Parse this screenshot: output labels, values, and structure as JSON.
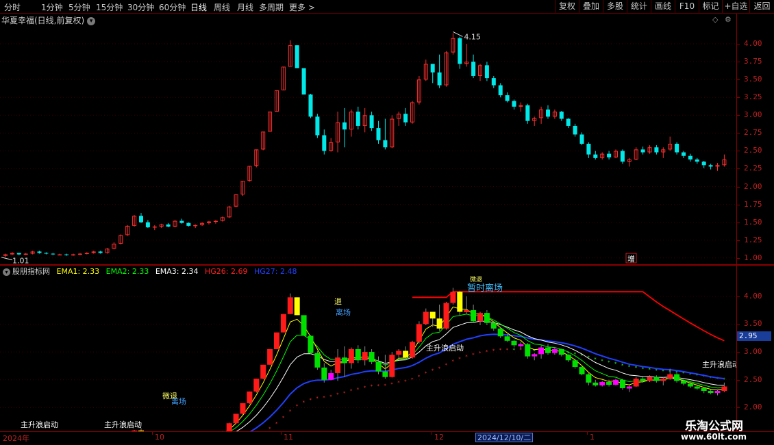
{
  "toolbar": {
    "timeframes": [
      "分时",
      "1分钟",
      "5分钟",
      "15分钟",
      "30分钟",
      "60分钟",
      "日线",
      "周线",
      "月线",
      "多周期",
      "更多"
    ],
    "active_timeframe": "日线",
    "more_arrow": ">",
    "right_buttons": [
      "复权",
      "叠加",
      "多股",
      "统计",
      "画线",
      "F10",
      "标记",
      "+自选",
      "返回"
    ]
  },
  "upper": {
    "title": "华夏幸福(日线,前复权)",
    "price_labels": [
      "4.00",
      "3.75",
      "3.50",
      "3.25",
      "3.00",
      "2.75",
      "2.50",
      "2.25",
      "2.00",
      "1.75",
      "1.50",
      "1.25",
      "1.00"
    ],
    "high_marker": "4.15",
    "low_marker": "1.01",
    "zeng_label": "增"
  },
  "lower": {
    "indicator_name": "股朋指标网",
    "legend": {
      "ema1": "EMA1: 2.33",
      "ema2": "EMA2: 2.33",
      "ema3": "EMA3: 2.34",
      "hg26": "HG26: 2.69",
      "hg27": "HG27: 2.48"
    },
    "price_labels": [
      "4.00",
      "3.50",
      "3.00",
      "2.50",
      "2.00"
    ],
    "last_price": "2.95",
    "annotations": {
      "zhushengqidong": "主升浪启动",
      "zanshilichang": "暂时离场",
      "lichang": "离场",
      "tui": "退",
      "weitui": "微退"
    }
  },
  "date_axis": {
    "labels": [
      "2024年",
      "10",
      "11",
      "12",
      "1"
    ],
    "cursor_date": "2024/12/10/二"
  },
  "watermark": {
    "main": "乐淘公式网",
    "sub": "www.60lt.com"
  },
  "colors": {
    "up": "#ff3030",
    "down": "#00e8e8",
    "background": "#000000",
    "axis": "#c02020",
    "ema1": "#ffff00",
    "ema2": "#00ff00",
    "ema3": "#ffffff",
    "hg26": "#ff0000",
    "hg27": "#2040ff"
  },
  "chart_data": {
    "type": "candlestick",
    "ylim_upper": [
      0.95,
      4.25
    ],
    "ylim_lower": [
      1.6,
      4.5
    ],
    "candles": [
      [
        1.03,
        1.06,
        1.01,
        1.05
      ],
      [
        1.05,
        1.08,
        1.04,
        1.07
      ],
      [
        1.07,
        1.07,
        1.04,
        1.05
      ],
      [
        1.05,
        1.07,
        1.04,
        1.06
      ],
      [
        1.06,
        1.1,
        1.05,
        1.09
      ],
      [
        1.09,
        1.1,
        1.06,
        1.07
      ],
      [
        1.07,
        1.08,
        1.05,
        1.06
      ],
      [
        1.06,
        1.07,
        1.04,
        1.05
      ],
      [
        1.05,
        1.06,
        1.04,
        1.05
      ],
      [
        1.05,
        1.06,
        1.03,
        1.04
      ],
      [
        1.04,
        1.06,
        1.03,
        1.05
      ],
      [
        1.05,
        1.07,
        1.04,
        1.06
      ],
      [
        1.06,
        1.08,
        1.05,
        1.07
      ],
      [
        1.07,
        1.1,
        1.06,
        1.09
      ],
      [
        1.09,
        1.1,
        1.06,
        1.07
      ],
      [
        1.07,
        1.14,
        1.06,
        1.13
      ],
      [
        1.13,
        1.22,
        1.12,
        1.2
      ],
      [
        1.2,
        1.33,
        1.19,
        1.32
      ],
      [
        1.32,
        1.46,
        1.31,
        1.45
      ],
      [
        1.45,
        1.6,
        1.44,
        1.59
      ],
      [
        1.59,
        1.63,
        1.49,
        1.5
      ],
      [
        1.5,
        1.53,
        1.42,
        1.43
      ],
      [
        1.43,
        1.46,
        1.39,
        1.44
      ],
      [
        1.44,
        1.48,
        1.42,
        1.47
      ],
      [
        1.47,
        1.49,
        1.43,
        1.44
      ],
      [
        1.44,
        1.53,
        1.43,
        1.52
      ],
      [
        1.52,
        1.55,
        1.48,
        1.49
      ],
      [
        1.49,
        1.5,
        1.44,
        1.45
      ],
      [
        1.45,
        1.47,
        1.42,
        1.46
      ],
      [
        1.46,
        1.5,
        1.45,
        1.49
      ],
      [
        1.49,
        1.52,
        1.47,
        1.51
      ],
      [
        1.51,
        1.53,
        1.48,
        1.52
      ],
      [
        1.52,
        1.58,
        1.51,
        1.57
      ],
      [
        1.57,
        1.73,
        1.56,
        1.72
      ],
      [
        1.72,
        1.89,
        1.71,
        1.89
      ],
      [
        1.89,
        2.08,
        1.87,
        2.08
      ],
      [
        2.08,
        2.29,
        2.07,
        2.29
      ],
      [
        2.29,
        2.52,
        2.27,
        2.52
      ],
      [
        2.52,
        2.77,
        2.51,
        2.77
      ],
      [
        2.77,
        3.05,
        2.77,
        3.05
      ],
      [
        3.05,
        3.35,
        3.05,
        3.35
      ],
      [
        3.35,
        3.68,
        3.35,
        3.68
      ],
      [
        3.68,
        4.05,
        3.68,
        3.98
      ],
      [
        3.98,
        3.98,
        3.66,
        3.66
      ],
      [
        3.66,
        3.32,
        3.29,
        3.29
      ],
      [
        3.29,
        3.3,
        2.96,
        2.98
      ],
      [
        2.98,
        3.02,
        2.68,
        2.72
      ],
      [
        2.72,
        2.8,
        2.45,
        2.5
      ],
      [
        2.5,
        2.68,
        2.49,
        2.62
      ],
      [
        2.62,
        3.05,
        2.48,
        2.9
      ],
      [
        2.9,
        3.1,
        2.55,
        2.8
      ],
      [
        2.8,
        3.08,
        2.7,
        3.05
      ],
      [
        3.05,
        3.12,
        2.8,
        2.85
      ],
      [
        2.85,
        3.1,
        2.76,
        3.0
      ],
      [
        3.0,
        3.05,
        2.78,
        2.82
      ],
      [
        2.82,
        2.92,
        2.6,
        2.65
      ],
      [
        2.65,
        2.95,
        2.52,
        2.55
      ],
      [
        2.55,
        3.0,
        2.54,
        2.95
      ],
      [
        2.95,
        3.05,
        2.85,
        3.02
      ],
      [
        3.02,
        3.1,
        2.85,
        2.9
      ],
      [
        2.9,
        3.2,
        2.88,
        3.18
      ],
      [
        3.18,
        3.55,
        3.15,
        3.5
      ],
      [
        3.5,
        3.78,
        3.48,
        3.72
      ],
      [
        3.72,
        3.65,
        3.45,
        3.6
      ],
      [
        3.6,
        3.85,
        3.38,
        3.42
      ],
      [
        3.42,
        3.9,
        3.4,
        3.88
      ],
      [
        3.88,
        4.15,
        3.85,
        4.08
      ],
      [
        4.08,
        4.1,
        3.65,
        3.72
      ],
      [
        3.72,
        4.0,
        3.68,
        3.75
      ],
      [
        3.75,
        3.85,
        3.52,
        3.55
      ],
      [
        3.55,
        3.72,
        3.48,
        3.7
      ],
      [
        3.7,
        3.75,
        3.48,
        3.52
      ],
      [
        3.52,
        3.55,
        3.38,
        3.42
      ],
      [
        3.42,
        3.45,
        3.25,
        3.28
      ],
      [
        3.28,
        3.32,
        3.18,
        3.2
      ],
      [
        3.2,
        3.22,
        3.08,
        3.12
      ],
      [
        3.12,
        3.18,
        3.05,
        3.14
      ],
      [
        3.14,
        3.16,
        2.88,
        2.92
      ],
      [
        2.92,
        2.98,
        2.85,
        2.96
      ],
      [
        2.96,
        3.12,
        2.88,
        3.08
      ],
      [
        3.08,
        3.14,
        2.95,
        2.98
      ],
      [
        2.98,
        3.08,
        2.95,
        3.05
      ],
      [
        3.05,
        3.06,
        2.92,
        2.95
      ],
      [
        2.95,
        2.96,
        2.82,
        2.85
      ],
      [
        2.85,
        2.88,
        2.7,
        2.73
      ],
      [
        2.73,
        2.76,
        2.58,
        2.6
      ],
      [
        2.6,
        2.62,
        2.4,
        2.45
      ],
      [
        2.45,
        2.5,
        2.38,
        2.4
      ],
      [
        2.4,
        2.48,
        2.38,
        2.46
      ],
      [
        2.46,
        2.5,
        2.38,
        2.41
      ],
      [
        2.41,
        2.52,
        2.4,
        2.5
      ],
      [
        2.5,
        2.52,
        2.32,
        2.35
      ],
      [
        2.35,
        2.4,
        2.28,
        2.38
      ],
      [
        2.38,
        2.55,
        2.37,
        2.52
      ],
      [
        2.52,
        2.56,
        2.45,
        2.48
      ],
      [
        2.48,
        2.58,
        2.46,
        2.55
      ],
      [
        2.55,
        2.58,
        2.45,
        2.48
      ],
      [
        2.48,
        2.55,
        2.4,
        2.52
      ],
      [
        2.52,
        2.7,
        2.5,
        2.6
      ],
      [
        2.6,
        2.62,
        2.45,
        2.48
      ],
      [
        2.48,
        2.5,
        2.4,
        2.43
      ],
      [
        2.43,
        2.46,
        2.35,
        2.38
      ],
      [
        2.38,
        2.4,
        2.32,
        2.35
      ],
      [
        2.35,
        2.36,
        2.26,
        2.3
      ],
      [
        2.3,
        2.32,
        2.24,
        2.28
      ],
      [
        2.28,
        2.33,
        2.22,
        2.3
      ],
      [
        2.3,
        2.45,
        2.28,
        2.38
      ]
    ]
  }
}
